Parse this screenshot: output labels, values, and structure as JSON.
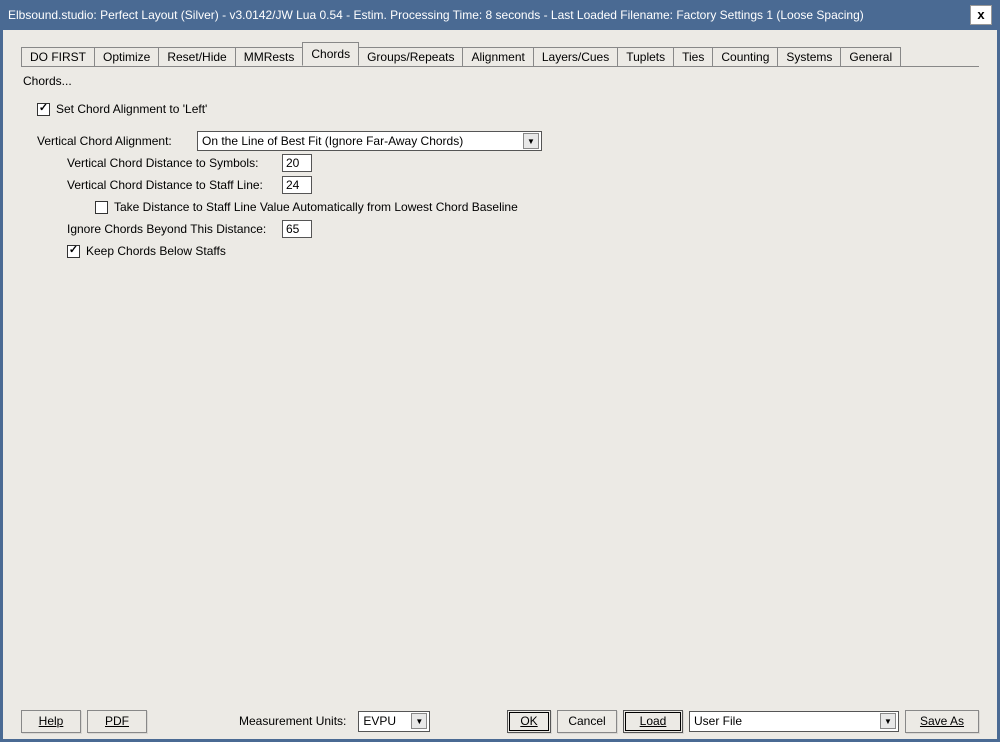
{
  "title": "Elbsound.studio: Perfect Layout (Silver) - v3.0142/JW Lua 0.54 - Estim. Processing Time: 8 seconds - Last Loaded Filename: Factory Settings 1 (Loose Spacing)",
  "tabs": [
    {
      "label": "DO FIRST"
    },
    {
      "label": "Optimize"
    },
    {
      "label": "Reset/Hide"
    },
    {
      "label": "MMRests"
    },
    {
      "label": "Chords"
    },
    {
      "label": "Groups/Repeats"
    },
    {
      "label": "Alignment"
    },
    {
      "label": "Layers/Cues"
    },
    {
      "label": "Tuplets"
    },
    {
      "label": "Ties"
    },
    {
      "label": "Counting"
    },
    {
      "label": "Systems"
    },
    {
      "label": "General"
    }
  ],
  "active_tab_index": 4,
  "panel": {
    "section_title": "Chords...",
    "set_left_label": "Set Chord Alignment to 'Left'",
    "set_left_checked": true,
    "vca_label": "Vertical Chord Alignment:",
    "vca_value": "On the Line of Best Fit (Ignore Far-Away Chords)",
    "dist_symbols_label": "Vertical Chord Distance to Symbols:",
    "dist_symbols_value": "20",
    "dist_staff_label": "Vertical Chord Distance to Staff Line:",
    "dist_staff_value": "24",
    "auto_baseline_label": "Take Distance to Staff Line Value Automatically from Lowest Chord Baseline",
    "auto_baseline_checked": false,
    "ignore_beyond_label": "Ignore Chords Beyond This Distance:",
    "ignore_beyond_value": "65",
    "keep_below_label": "Keep Chords Below Staffs",
    "keep_below_checked": true
  },
  "bottom": {
    "help": "Help",
    "pdf": "PDF",
    "meas_label": "Measurement Units:",
    "meas_value": "EVPU",
    "ok": "OK",
    "cancel": "Cancel",
    "load": "Load",
    "file_value": "User File",
    "save_as": "Save As"
  }
}
